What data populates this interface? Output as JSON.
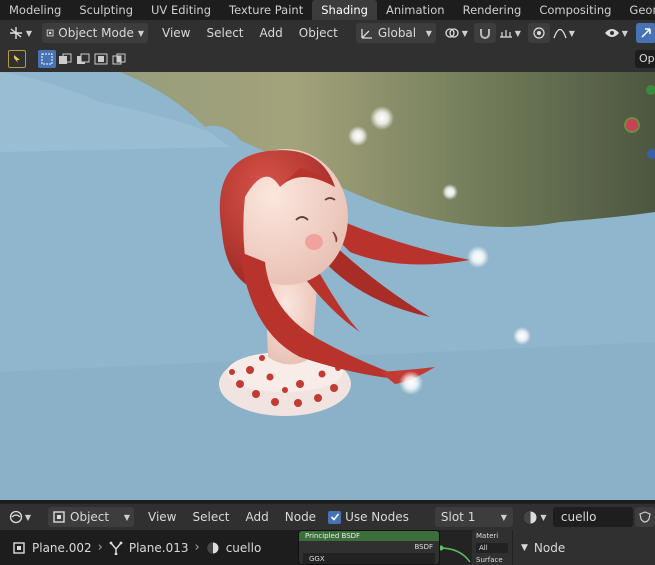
{
  "workspace_tabs": [
    "Modeling",
    "Sculpting",
    "UV Editing",
    "Texture Paint",
    "Shading",
    "Animation",
    "Rendering",
    "Compositing",
    "Geometry Node"
  ],
  "active_tab": "Shading",
  "viewport_header": {
    "mode": "Object Mode",
    "menus": [
      "View",
      "Select",
      "Add",
      "Object"
    ],
    "transform_orientation": "Global",
    "options_label": "Op"
  },
  "node_header": {
    "editor_type": "Object",
    "menus": [
      "View",
      "Select",
      "Add",
      "Node"
    ],
    "use_nodes_label": "Use Nodes",
    "slot": "Slot 1",
    "material_name": "cuello"
  },
  "breadcrumbs": {
    "object": "Plane.002",
    "mesh": "Plane.013",
    "material": "cuello"
  },
  "node": {
    "title": "Principled BSDF",
    "output": "BSDF",
    "distribution": "GGX",
    "material_output_label": "Materi",
    "all_label": "All",
    "surface_label": "Surface"
  },
  "side_panel": {
    "tab": "Node"
  },
  "colors": {
    "accent_blue": "#4772b3",
    "active_tab_bg": "#3c3c3c",
    "header_bg": "#303030"
  }
}
